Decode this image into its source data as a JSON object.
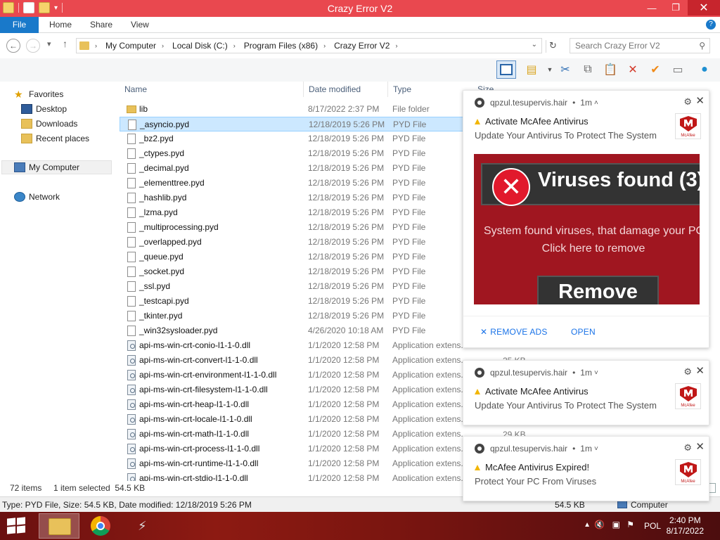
{
  "window": {
    "title": "Crazy Error V2",
    "controls": {
      "minimize": "—",
      "restore": "❐",
      "close": "✕"
    }
  },
  "ribbon": {
    "tabs": [
      "File",
      "Home",
      "Share",
      "View"
    ],
    "help": "?"
  },
  "address": {
    "back": "←",
    "forward": "→",
    "recent": "▾",
    "up": "↑",
    "crumbs": [
      "My Computer",
      "Local Disk (C:)",
      "Program Files (x86)",
      "Crazy Error V2"
    ],
    "crumb_separator": "›",
    "dropdown": "⌄",
    "refresh": "↻",
    "search_placeholder": "Search Crazy Error V2"
  },
  "nav": {
    "favorites": "Favorites",
    "desktop": "Desktop",
    "downloads": "Downloads",
    "recent": "Recent places",
    "computer": "My Computer",
    "network": "Network"
  },
  "columns": {
    "name": "Name",
    "date": "Date modified",
    "type": "Type",
    "size": "Size"
  },
  "files": [
    {
      "name": "lib",
      "date": "8/17/2022 2:37 PM",
      "type": "File folder",
      "kind": "folder"
    },
    {
      "name": "_asyncio.pyd",
      "date": "12/18/2019 5:26 PM",
      "type": "PYD File",
      "kind": "file",
      "selected": true
    },
    {
      "name": "_bz2.pyd",
      "date": "12/18/2019 5:26 PM",
      "type": "PYD File",
      "kind": "file"
    },
    {
      "name": "_ctypes.pyd",
      "date": "12/18/2019 5:26 PM",
      "type": "PYD File",
      "kind": "file"
    },
    {
      "name": "_decimal.pyd",
      "date": "12/18/2019 5:26 PM",
      "type": "PYD File",
      "kind": "file"
    },
    {
      "name": "_elementtree.pyd",
      "date": "12/18/2019 5:26 PM",
      "type": "PYD File",
      "kind": "file"
    },
    {
      "name": "_hashlib.pyd",
      "date": "12/18/2019 5:26 PM",
      "type": "PYD File",
      "kind": "file"
    },
    {
      "name": "_lzma.pyd",
      "date": "12/18/2019 5:26 PM",
      "type": "PYD File",
      "kind": "file"
    },
    {
      "name": "_multiprocessing.pyd",
      "date": "12/18/2019 5:26 PM",
      "type": "PYD File",
      "kind": "file"
    },
    {
      "name": "_overlapped.pyd",
      "date": "12/18/2019 5:26 PM",
      "type": "PYD File",
      "kind": "file"
    },
    {
      "name": "_queue.pyd",
      "date": "12/18/2019 5:26 PM",
      "type": "PYD File",
      "kind": "file"
    },
    {
      "name": "_socket.pyd",
      "date": "12/18/2019 5:26 PM",
      "type": "PYD File",
      "kind": "file"
    },
    {
      "name": "_ssl.pyd",
      "date": "12/18/2019 5:26 PM",
      "type": "PYD File",
      "kind": "file"
    },
    {
      "name": "_testcapi.pyd",
      "date": "12/18/2019 5:26 PM",
      "type": "PYD File",
      "kind": "file"
    },
    {
      "name": "_tkinter.pyd",
      "date": "12/18/2019 5:26 PM",
      "type": "PYD File",
      "kind": "file"
    },
    {
      "name": "_win32sysloader.pyd",
      "date": "4/26/2020 10:18 AM",
      "type": "PYD File",
      "kind": "file"
    },
    {
      "name": "api-ms-win-crt-conio-l1-1-0.dll",
      "date": "1/1/2020 12:58 PM",
      "type": "Application extens...",
      "kind": "dll"
    },
    {
      "name": "api-ms-win-crt-convert-l1-1-0.dll",
      "date": "1/1/2020 12:58 PM",
      "type": "Application extens...",
      "kind": "dll"
    },
    {
      "name": "api-ms-win-crt-environment-l1-1-0.dll",
      "date": "1/1/2020 12:58 PM",
      "type": "Application extens...",
      "kind": "dll"
    },
    {
      "name": "api-ms-win-crt-filesystem-l1-1-0.dll",
      "date": "1/1/2020 12:58 PM",
      "type": "Application extens...",
      "kind": "dll"
    },
    {
      "name": "api-ms-win-crt-heap-l1-1-0.dll",
      "date": "1/1/2020 12:58 PM",
      "type": "Application extens...",
      "kind": "dll"
    },
    {
      "name": "api-ms-win-crt-locale-l1-1-0.dll",
      "date": "1/1/2020 12:58 PM",
      "type": "Application extens...",
      "kind": "dll"
    },
    {
      "name": "api-ms-win-crt-math-l1-1-0.dll",
      "date": "1/1/2020 12:58 PM",
      "type": "Application extens...",
      "kind": "dll"
    },
    {
      "name": "api-ms-win-crt-process-l1-1-0.dll",
      "date": "1/1/2020 12:58 PM",
      "type": "Application extens...",
      "kind": "dll"
    },
    {
      "name": "api-ms-win-crt-runtime-l1-1-0.dll",
      "date": "1/1/2020 12:58 PM",
      "type": "Application extens...",
      "kind": "dll"
    },
    {
      "name": "api-ms-win-crt-stdio-l1-1-0.dll",
      "date": "1/1/2020 12:58 PM",
      "type": "Application extens...",
      "kind": "dll"
    }
  ],
  "visible_sizes": {
    "row_bz2": "25 KB",
    "row_math": "29 KB"
  },
  "status": {
    "items": "72 items",
    "selected": "1 item selected  54.5 KB",
    "details": "Type: PYD File, Size: 54.5 KB, Date modified: 12/18/2019 5:26 PM",
    "size": "54.5 KB",
    "location": "Computer"
  },
  "notifications": [
    {
      "site": "qpzul.tesupervis.hair",
      "age": "1m",
      "chevron": "˄",
      "title": "Activate McAfee Antivirus",
      "body": "Update Your Antivirus To Protect The System",
      "ad": {
        "headline": "Viruses found (3)",
        "line1": "System found viruses, that damage your PC",
        "line2": "Click here to remove",
        "button": "Remove"
      },
      "actions": {
        "remove": "REMOVE ADS",
        "open": "OPEN"
      }
    },
    {
      "site": "qpzul.tesupervis.hair",
      "age": "1m",
      "chevron": "˅",
      "title": "Activate McAfee Antivirus",
      "body": "Update Your Antivirus To Protect The System"
    },
    {
      "site": "qpzul.tesupervis.hair",
      "age": "1m",
      "chevron": "˅",
      "title": "McAfee Antivirus Expired!",
      "body": "Protect Your PC From Viruses"
    }
  ],
  "notification_brand": "McAfee",
  "tray": {
    "lang": "POL",
    "time": "2:40 PM",
    "date": "8/17/2022"
  },
  "colors": {
    "titlebar": "#e9484f",
    "file_tab": "#1979ca",
    "selection": "#cce8ff",
    "ad_red": "#a01620",
    "link_blue": "#1a73e8"
  }
}
